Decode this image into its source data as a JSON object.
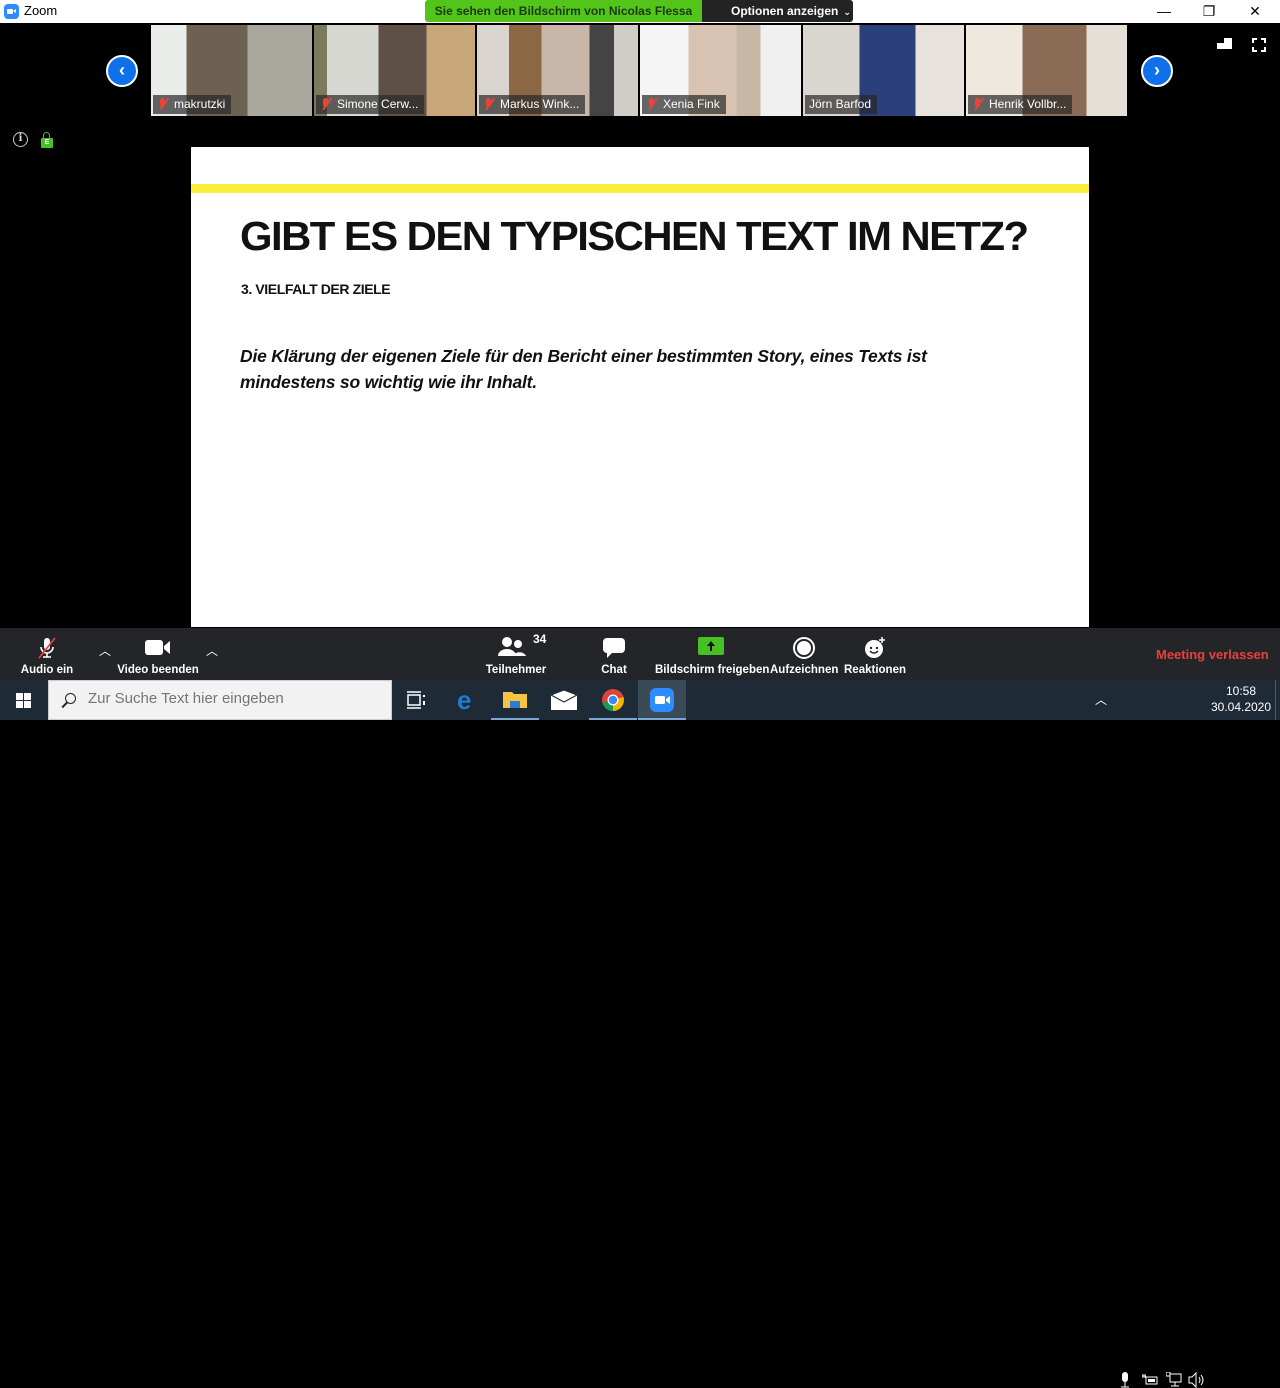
{
  "window": {
    "app_title": "Zoom",
    "share_banner": "Sie sehen den Bildschirm von Nicolas Flessa",
    "options_label": "Optionen anzeigen",
    "controls": {
      "minimize": "—",
      "restore": "❐",
      "close": "✕"
    }
  },
  "gallery": {
    "prev_icon": "‹",
    "next_icon": "›",
    "participants": [
      {
        "name": "makrutzki",
        "muted": true,
        "bg": "#8a8378"
      },
      {
        "name": "Simone Cerw...",
        "muted": true,
        "bg": "#a8a295"
      },
      {
        "name": "Markus Wink...",
        "muted": true,
        "bg": "#9c8f82"
      },
      {
        "name": "Xenia Fink",
        "muted": true,
        "bg": "#cfc8c4"
      },
      {
        "name": "Jörn Barfod",
        "muted": false,
        "bg": "#b4aea4"
      },
      {
        "name": "Henrik Vollbr...",
        "muted": true,
        "bg": "#8e8274"
      }
    ]
  },
  "meeting_info": {
    "info_icon": "i",
    "encryption_icon": "E"
  },
  "slide": {
    "title": "GIBT ES DEN TYPISCHEN TEXT IM NETZ?",
    "subtitle": "3. VIELFALT DER ZIELE",
    "body": "Die Klärung der eigenen Ziele für den Bericht einer bestimmten Story, eines Texts ist mindestens so wichtig wie ihr Inhalt.",
    "accent_color": "#f9ef3a"
  },
  "toolbar": {
    "audio": "Audio ein",
    "video": "Video beenden",
    "participants": "Teilnehmer",
    "participant_count": "34",
    "chat": "Chat",
    "share": "Bildschirm freigeben",
    "record": "Aufzeichnen",
    "reactions": "Reaktionen",
    "leave": "Meeting verlassen",
    "caret": "^"
  },
  "taskbar": {
    "search_placeholder": "Zur Suche Text hier eingeben",
    "apps": [
      "Task View",
      "Microsoft Edge",
      "File Explorer",
      "Mail",
      "Google Chrome",
      "Zoom"
    ],
    "time": "10:58",
    "date": "30.04.2020",
    "tray_icons": [
      "chevron-up",
      "microphone",
      "battery",
      "network",
      "volume"
    ]
  }
}
